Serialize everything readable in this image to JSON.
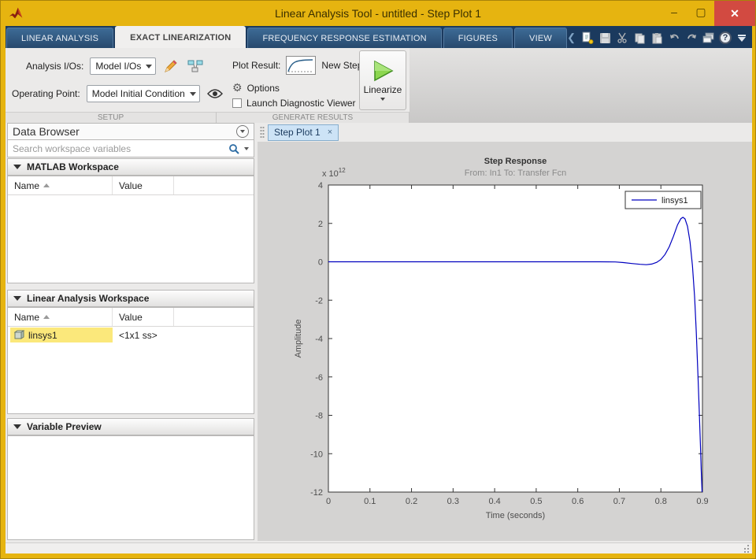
{
  "window": {
    "title": "Linear Analysis Tool - untitled - Step Plot 1",
    "controls": {
      "minimize": "–",
      "maximize": "▢",
      "close": "✕"
    }
  },
  "ribbon_tabs": [
    {
      "label": "LINEAR ANALYSIS",
      "active": false
    },
    {
      "label": "EXACT LINEARIZATION",
      "active": true
    },
    {
      "label": "FREQUENCY RESPONSE ESTIMATION",
      "active": false
    },
    {
      "label": "FIGURES",
      "active": false
    },
    {
      "label": "VIEW",
      "active": false
    }
  ],
  "qat": {
    "chevron": "❮",
    "help_glyph": "?",
    "icons": [
      "new-session",
      "save",
      "cut",
      "copy",
      "paste",
      "undo",
      "redo",
      "window-layout",
      "help",
      "collapse-ribbon"
    ]
  },
  "toolbar": {
    "analysis_ios_label": "Analysis I/Os:",
    "analysis_ios_value": "Model I/Os",
    "operating_point_label": "Operating Point:",
    "operating_point_value": "Model Initial Condition",
    "setup_section": "SETUP",
    "plot_result_label": "Plot Result:",
    "plot_result_value": "New Step",
    "options_label": "Options",
    "options_gear": "⚙",
    "launch_diagnostic_label": "Launch Diagnostic Viewer",
    "linearize_label": "Linearize",
    "generate_section": "GENERATE RESULTS"
  },
  "data_browser": {
    "title": "Data Browser",
    "search_placeholder": "Search workspace variables",
    "matlab_workspace": {
      "title": "MATLAB Workspace",
      "columns": [
        "Name",
        "Value"
      ],
      "rows": []
    },
    "linear_workspace": {
      "title": "Linear Analysis Workspace",
      "columns": [
        "Name",
        "Value"
      ],
      "rows": [
        {
          "name": "linsys1",
          "value": "<1x1 ss>"
        }
      ]
    },
    "variable_preview": {
      "title": "Variable Preview"
    }
  },
  "plot_tab": {
    "label": "Step Plot 1",
    "close": "×"
  },
  "chart_data": {
    "type": "line",
    "title": "Step Response",
    "subtitle": "From: In1  To: Transfer Fcn",
    "xlabel": "Time (seconds)",
    "ylabel": "Amplitude",
    "y_multiplier_base": "x 10",
    "y_multiplier_exp": "12",
    "xlim": [
      0,
      0.9
    ],
    "ylim": [
      -12,
      4
    ],
    "xtick_labels": [
      "0",
      "0.1",
      "0.2",
      "0.3",
      "0.4",
      "0.5",
      "0.6",
      "0.7",
      "0.8",
      "0.9"
    ],
    "xticks": [
      0,
      0.1,
      0.2,
      0.3,
      0.4,
      0.5,
      0.6,
      0.7,
      0.8,
      0.9
    ],
    "ytick_labels": [
      "4",
      "2",
      "0",
      "-2",
      "-4",
      "-6",
      "-8",
      "-10",
      "-12"
    ],
    "yticks": [
      4,
      2,
      0,
      -2,
      -4,
      -6,
      -8,
      -10,
      -12
    ],
    "grid": false,
    "legend": {
      "position": "top-right",
      "entries": [
        {
          "label": "linsys1",
          "color": "#0000bf"
        }
      ]
    },
    "series": [
      {
        "name": "linsys1",
        "color": "#0000bf",
        "points": [
          [
            0,
            0
          ],
          [
            0.3,
            0
          ],
          [
            0.55,
            0
          ],
          [
            0.65,
            0
          ],
          [
            0.69,
            -0.01
          ],
          [
            0.71,
            -0.04
          ],
          [
            0.73,
            -0.09
          ],
          [
            0.75,
            -0.13
          ],
          [
            0.765,
            -0.15
          ],
          [
            0.778,
            -0.12
          ],
          [
            0.79,
            -0.03
          ],
          [
            0.8,
            0.12
          ],
          [
            0.81,
            0.38
          ],
          [
            0.82,
            0.78
          ],
          [
            0.83,
            1.32
          ],
          [
            0.84,
            1.92
          ],
          [
            0.848,
            2.25
          ],
          [
            0.853,
            2.32
          ],
          [
            0.858,
            2.24
          ],
          [
            0.864,
            1.85
          ],
          [
            0.87,
            1.05
          ],
          [
            0.876,
            -0.2
          ],
          [
            0.881,
            -1.8
          ],
          [
            0.885,
            -3.6
          ],
          [
            0.889,
            -5.8
          ],
          [
            0.892,
            -7.6
          ],
          [
            0.895,
            -9.5
          ],
          [
            0.897,
            -10.8
          ],
          [
            0.899,
            -12
          ]
        ]
      }
    ]
  },
  "colors": {
    "titlebar_gold": "#e6b410",
    "close_red": "#d24a41",
    "tabbar_navy": "#1b3a5e",
    "active_tab_bg": "#f0efee",
    "selection_yellow": "#fbe87b",
    "doc_tab_blue": "#cde3f6",
    "plot_bg": "#d4d3d2",
    "curve_blue": "#0000bf"
  }
}
